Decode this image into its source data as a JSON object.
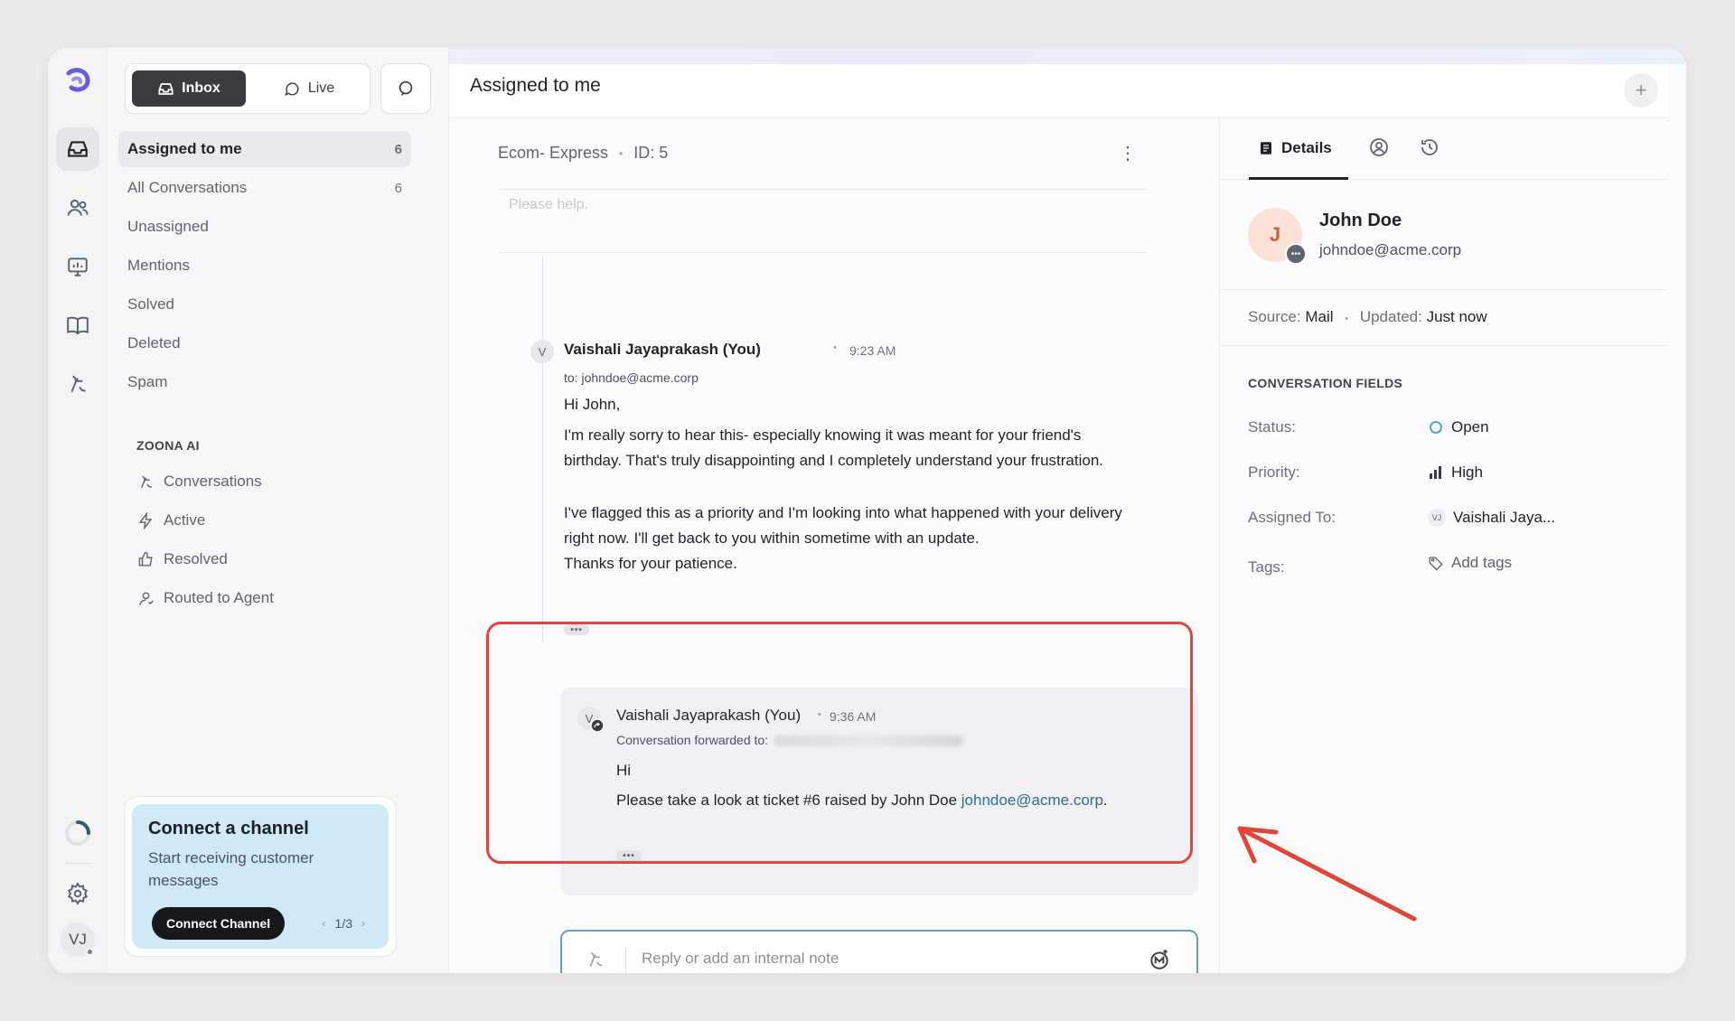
{
  "colors": {
    "accent": "#5fa3c2",
    "highlight": "#e0463a",
    "arrow": "#e0463a",
    "status_open": "#5fa3c2",
    "promo_bg": "#cfe9f6",
    "avatar_bg": "#fde2d8"
  },
  "rail": {
    "icons": [
      "logo-icon",
      "inbox-icon",
      "contacts-icon",
      "reports-icon",
      "knowledge-base-icon",
      "ai-agent-icon",
      "loading-icon",
      "settings-icon"
    ],
    "user_initials": "VJ"
  },
  "sidebar": {
    "segment": {
      "inbox_label": "Inbox",
      "live_label": "Live"
    },
    "items": [
      {
        "label": "Assigned to me",
        "count": "6"
      },
      {
        "label": "All Conversations",
        "count": "6"
      },
      {
        "label": "Unassigned",
        "count": ""
      },
      {
        "label": "Mentions",
        "count": ""
      },
      {
        "label": "Solved",
        "count": ""
      },
      {
        "label": "Deleted",
        "count": ""
      },
      {
        "label": "Spam",
        "count": ""
      }
    ],
    "ai_section_label": "ZOONA AI",
    "ai_items": [
      {
        "label": "Conversations",
        "icon": "ai-agent-icon"
      },
      {
        "label": "Active",
        "icon": "bolt-icon"
      },
      {
        "label": "Resolved",
        "icon": "thumbs-up-icon"
      },
      {
        "label": "Routed to Agent",
        "icon": "agent-icon"
      }
    ],
    "promo": {
      "title": "Connect a channel",
      "subtitle": "Start receiving customer messages",
      "button": "Connect Channel",
      "page": "1/3"
    }
  },
  "header": {
    "title": "Assigned to me"
  },
  "conversation": {
    "channel": "Ecom- Express",
    "id_label": "ID: 5",
    "preview": "Please help.",
    "messages": [
      {
        "initial": "V",
        "author": "Vaishali Jayaprakash (You)",
        "time": "9:23 AM",
        "to": "to: johndoe@acme.corp",
        "greeting": "Hi John,",
        "p1": "I'm really sorry to hear this- especially knowing it was meant for your friend's birthday. That's truly disappointing and I completely understand your frustration.",
        "p2": "I've flagged this as a priority and I'm looking into what happened with your delivery right now. I'll get back to you within sometime with an update.",
        "p3": "Thanks for your patience."
      },
      {
        "initial": "V",
        "author": "Vaishali Jayaprakash (You)",
        "time": "9:36 AM",
        "forwarded_label": "Conversation forwarded to:",
        "greeting": "Hi",
        "body_prefix": "Please take a look at ticket #6 raised by John Doe ",
        "body_link": "johndoe@acme.corp",
        "body_suffix": "."
      }
    ],
    "reply_placeholder": "Reply or add an internal note"
  },
  "details": {
    "tab_label": "Details",
    "contact": {
      "initial": "J",
      "name": "John Doe",
      "email": "johndoe@acme.corp"
    },
    "source_label": "Source:",
    "source_value": "Mail",
    "updated_label": "Updated:",
    "updated_value": "Just now",
    "fields_label": "CONVERSATION FIELDS",
    "fields": {
      "status_label": "Status:",
      "status_value": "Open",
      "priority_label": "Priority:",
      "priority_value": "High",
      "assigned_label": "Assigned To:",
      "assigned_initials": "VJ",
      "assigned_value": "Vaishali Jaya...",
      "tags_label": "Tags:",
      "tags_value": "Add tags"
    }
  }
}
